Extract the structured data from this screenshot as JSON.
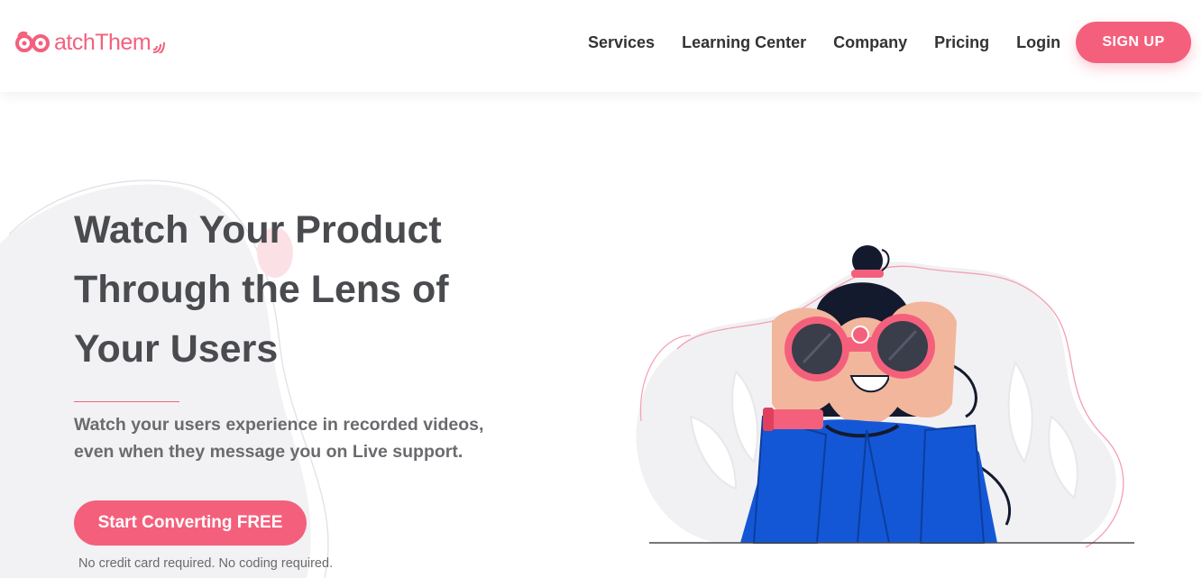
{
  "brand": {
    "name": "WatchThem",
    "text_after_mark": "atchThem",
    "color": "#f4607c"
  },
  "nav": {
    "items": [
      {
        "label": "Services"
      },
      {
        "label": "Learning Center"
      },
      {
        "label": "Company"
      },
      {
        "label": "Pricing"
      },
      {
        "label": "Login"
      }
    ],
    "signup_label": "SIGN UP"
  },
  "hero": {
    "title_lines": [
      "Watch Your Product",
      "Through the Lens of",
      "Your Users"
    ],
    "subtitle_lines": [
      "Watch your users experience in recorded videos,",
      "even when they message you on Live support."
    ],
    "cta_label": "Start Converting FREE",
    "note": "No credit card required. No coding required."
  },
  "icons": {
    "logo": "binoculars-logo-icon",
    "illustration": "woman-with-binoculars-illustration"
  },
  "colors": {
    "accent": "#f4607c",
    "heading": "#4a4b4f",
    "body_text": "#6b6b6f",
    "shirt": "#1457d6"
  }
}
